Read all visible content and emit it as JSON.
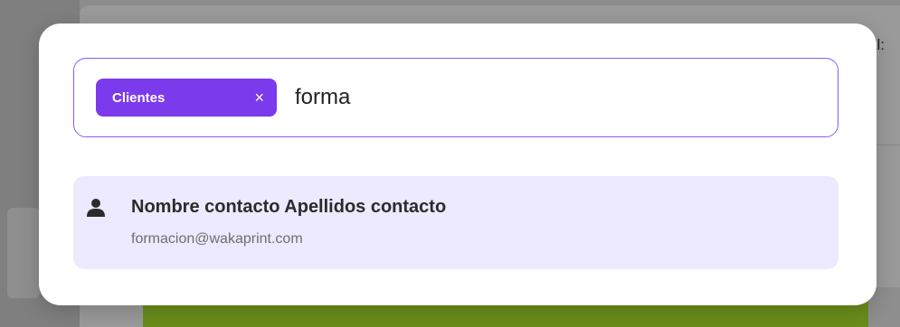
{
  "background": {
    "label": "al:"
  },
  "search": {
    "filter_chip": {
      "label": "Clientes",
      "remove_glyph": "×"
    },
    "query": "forma"
  },
  "results": [
    {
      "icon": "person-icon",
      "name": "Nombre contacto Apellidos contacto",
      "email": "formacion@wakaprint.com"
    }
  ],
  "colors": {
    "accent": "#7c3aed",
    "border": "#8b5cf6",
    "result_bg": "#ede9fe",
    "backdrop": "#8c8c8c"
  }
}
